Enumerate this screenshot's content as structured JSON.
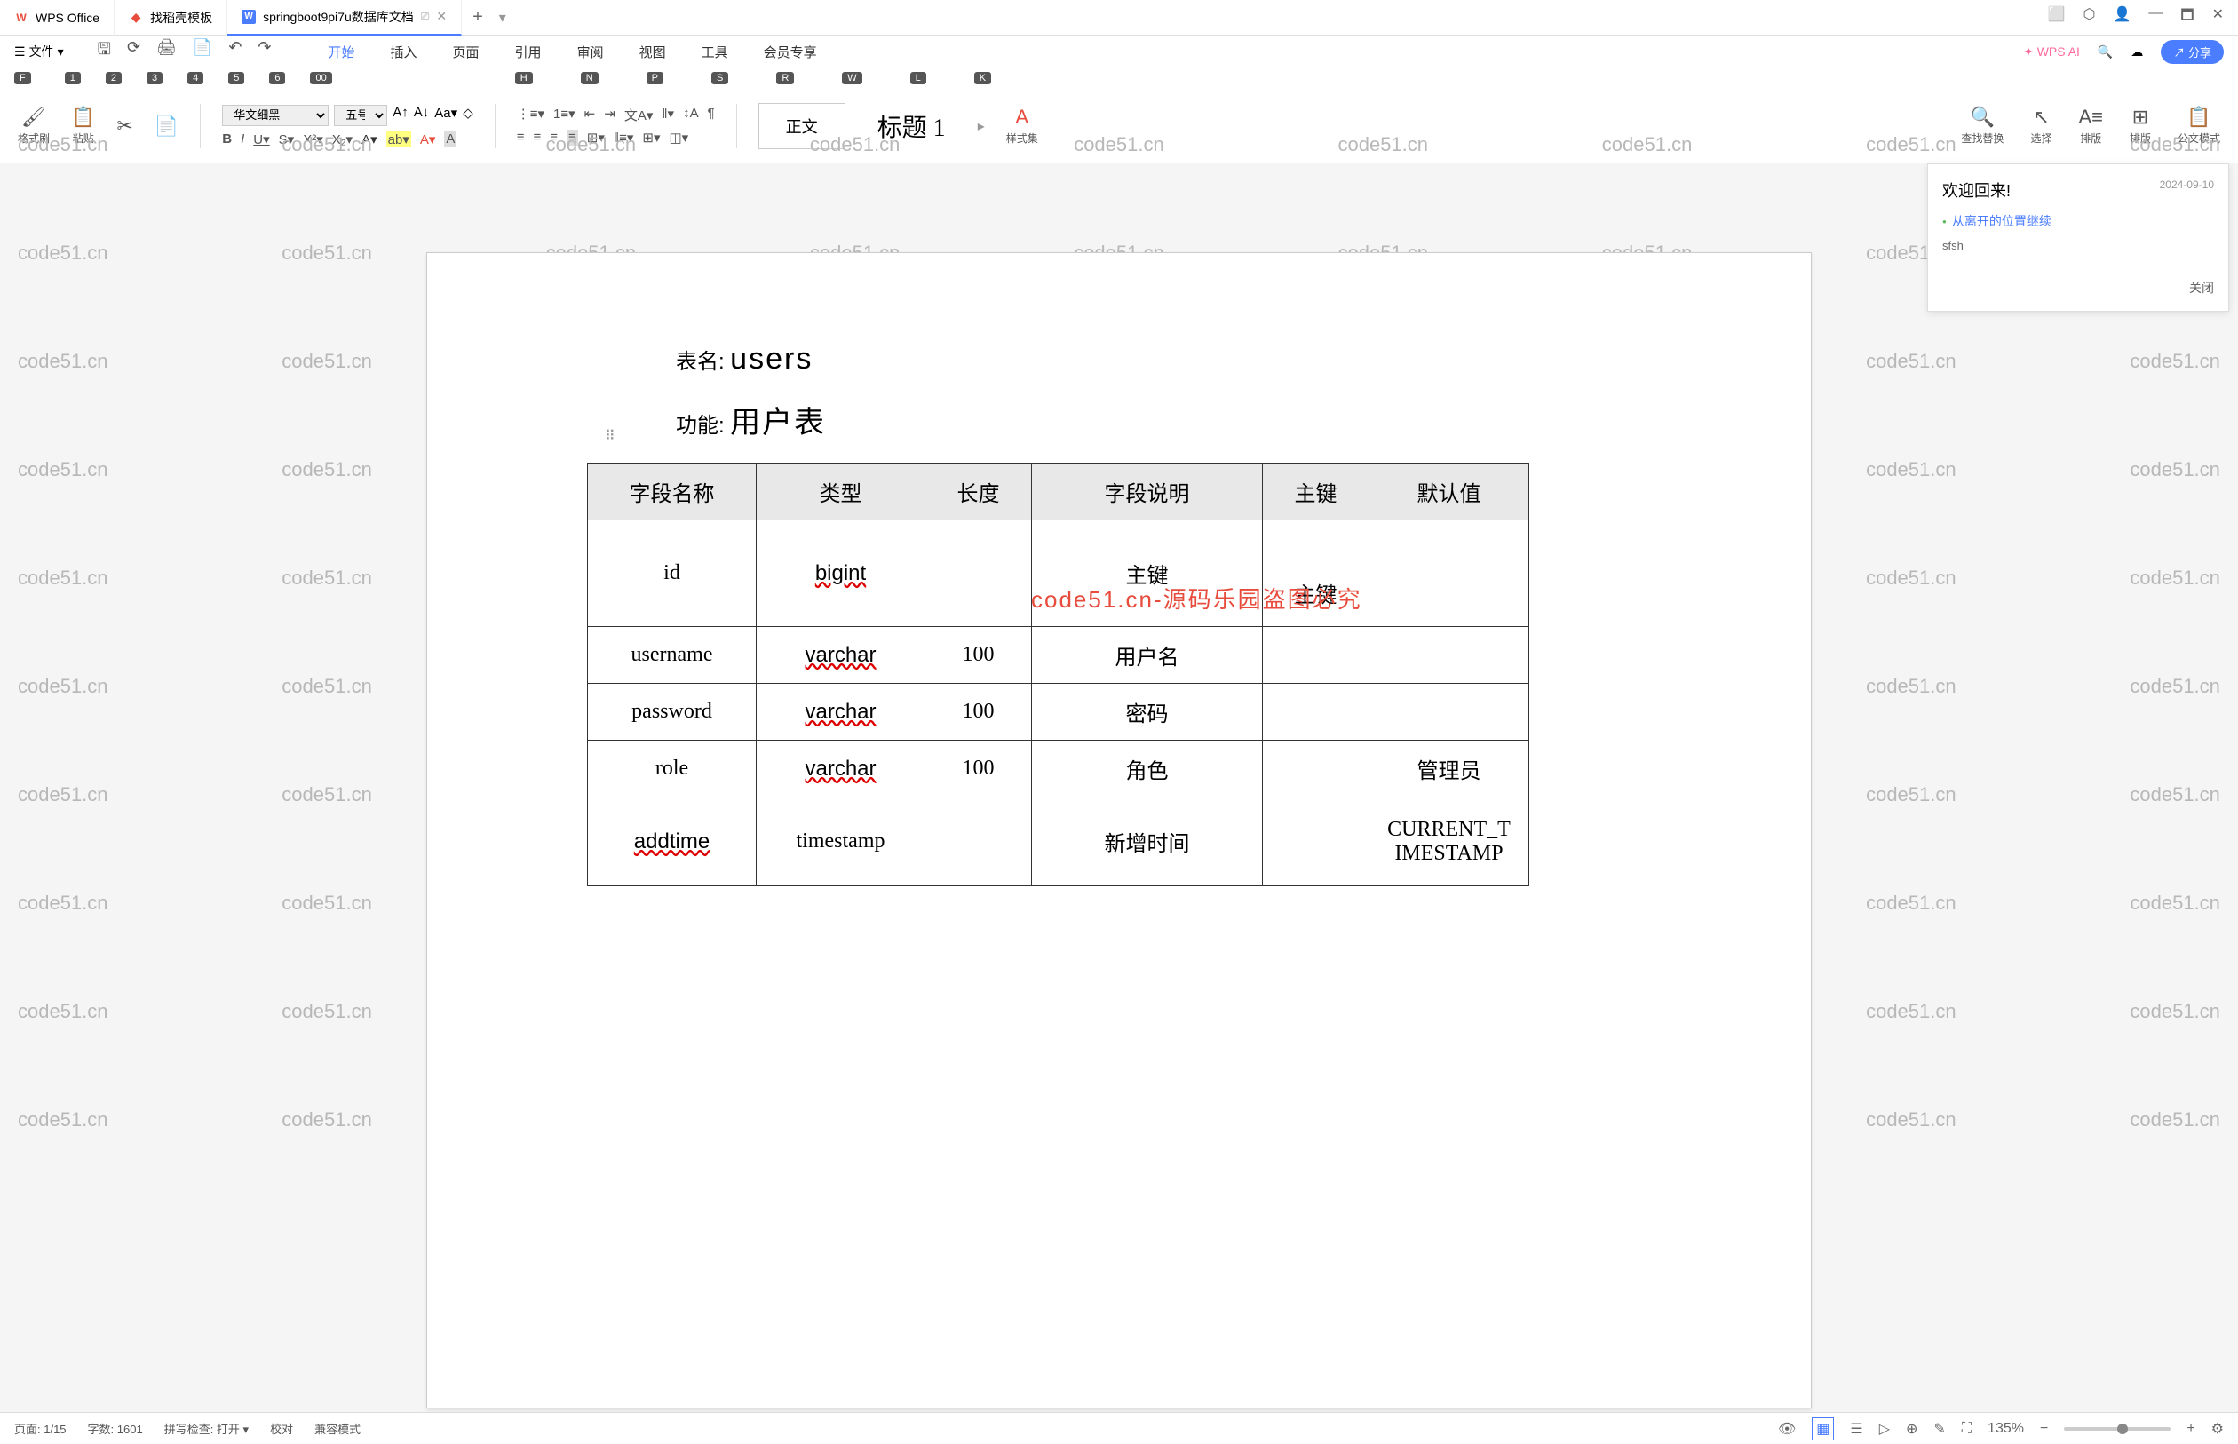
{
  "titlebar": {
    "tabs": [
      {
        "icon": "W",
        "label": "WPS Office"
      },
      {
        "icon": "D",
        "label": "找稻壳模板"
      },
      {
        "icon": "W",
        "label": "springboot9pi7u数据库文档"
      }
    ],
    "window_controls": [
      "⬜",
      "⬡",
      "👤",
      "—",
      "🗖",
      "✕"
    ]
  },
  "menubar": {
    "file": "文件",
    "tabs": [
      "开始",
      "插入",
      "页面",
      "引用",
      "审阅",
      "视图",
      "工具",
      "会员专享"
    ],
    "wps_ai": "WPS AI",
    "cloud": "☁",
    "share": "分享"
  },
  "shortcuts": {
    "file_key": "F",
    "quick_keys": [
      "1",
      "2",
      "3",
      "4",
      "5",
      "6",
      "00"
    ],
    "menu_keys": [
      "H",
      "N",
      "P",
      "S",
      "R",
      "W",
      "L",
      "K"
    ]
  },
  "ribbon": {
    "format_brush": "格式刷",
    "paste": "粘贴",
    "font_name": "华文细黑",
    "font_size": "五号",
    "style_body": "正文",
    "style_heading": "标题 1",
    "style_set": "样式集",
    "find_replace": "查找替换",
    "select": "选择",
    "layout": "排版",
    "arrange": "排版",
    "official_mode": "公文模式"
  },
  "welcome": {
    "title": "欢迎回来!",
    "date": "2024-09-10",
    "link": "从离开的位置继续",
    "text": "sfsh",
    "close": "关闭"
  },
  "document": {
    "table_name_label": "表名:",
    "table_name": "users",
    "function_label": "功能:",
    "function": "用户表",
    "overlay_text": "code51.cn-源码乐园盗图必究",
    "headers": [
      "字段名称",
      "类型",
      "长度",
      "字段说明",
      "主键",
      "默认值"
    ],
    "rows": [
      {
        "name": "id",
        "type": "bigint",
        "len": "",
        "desc": "主键",
        "pk": "主键",
        "def": ""
      },
      {
        "name": "username",
        "type": "varchar",
        "len": "100",
        "desc": "用户名",
        "pk": "",
        "def": ""
      },
      {
        "name": "password",
        "type": "varchar",
        "len": "100",
        "desc": "密码",
        "pk": "",
        "def": ""
      },
      {
        "name": "role",
        "type": "varchar",
        "len": "100",
        "desc": "角色",
        "pk": "",
        "def": "管理员"
      },
      {
        "name": "addtime",
        "type": "timestamp",
        "len": "",
        "desc": "新增时间",
        "pk": "",
        "def": "CURRENT_TIMESTAMP"
      }
    ]
  },
  "watermark": "code51.cn",
  "statusbar": {
    "page": "页面: 1/15",
    "words": "字数: 1601",
    "spellcheck": "拼写检查: 打开",
    "proofread": "校对",
    "compat": "兼容模式",
    "zoom": "135%"
  }
}
